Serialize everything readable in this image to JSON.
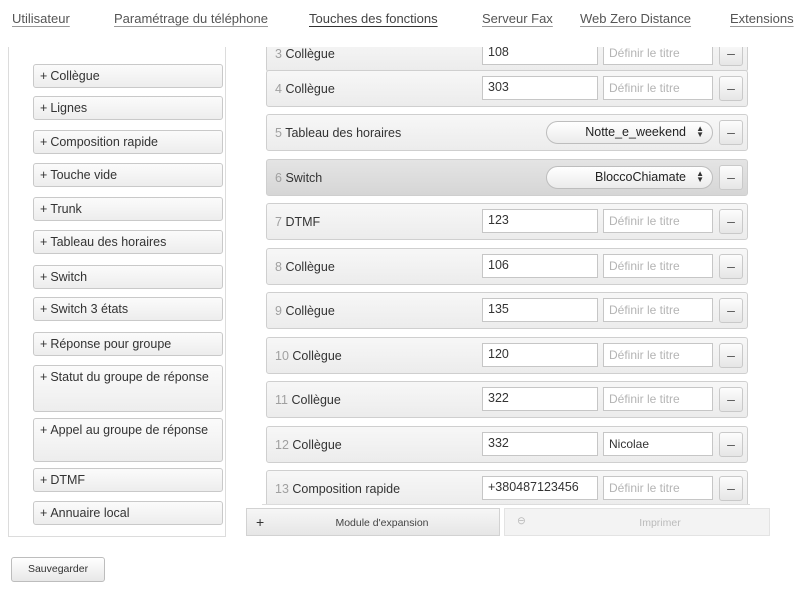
{
  "tabs": [
    {
      "label": "Utilisateur"
    },
    {
      "label": "Paramétrage du téléphone"
    },
    {
      "label": "Touches des fonctions"
    },
    {
      "label": "Serveur Fax"
    },
    {
      "label": "Web Zero Distance"
    },
    {
      "label": "Extensions"
    }
  ],
  "active_tab": "Touches des fonctions",
  "palette": {
    "plus_symbol": "+",
    "items": [
      {
        "label": "Collègue"
      },
      {
        "label": "Lignes"
      },
      {
        "label": "Composition rapide"
      },
      {
        "label": "Touche vide"
      },
      {
        "label": "Trunk"
      },
      {
        "label": "Tableau des horaires"
      },
      {
        "label": "Switch"
      },
      {
        "label": "Switch 3 états"
      },
      {
        "label": "Réponse pour groupe"
      },
      {
        "label": "Statut du groupe de réponse"
      },
      {
        "label": "Appel au groupe de réponse"
      },
      {
        "label": "DTMF"
      },
      {
        "label": "Annuaire local"
      }
    ]
  },
  "buttons": {
    "minus_symbol": "–",
    "title_placeholder": "Définir le titre",
    "rows": [
      {
        "num": "3",
        "type": "Collègue",
        "value": "108",
        "title": "",
        "kind": "input"
      },
      {
        "num": "4",
        "type": "Collègue",
        "value": "303",
        "title": "",
        "kind": "input"
      },
      {
        "num": "5",
        "type": "Tableau des horaires",
        "select": "Notte_e_weekend",
        "kind": "select"
      },
      {
        "num": "6",
        "type": "Switch",
        "select": "BloccoChiamate",
        "kind": "select",
        "selected": true
      },
      {
        "num": "7",
        "type": "DTMF",
        "value": "123",
        "title": "",
        "kind": "input"
      },
      {
        "num": "8",
        "type": "Collègue",
        "value": "106",
        "title": "",
        "kind": "input"
      },
      {
        "num": "9",
        "type": "Collègue",
        "value": "135",
        "title": "",
        "kind": "input"
      },
      {
        "num": "10",
        "type": "Collègue",
        "value": "120",
        "title": "",
        "kind": "input"
      },
      {
        "num": "11",
        "type": "Collègue",
        "value": "322",
        "title": "",
        "kind": "input"
      },
      {
        "num": "12",
        "type": "Collègue",
        "value": "332",
        "title": "Nicolae",
        "kind": "input"
      },
      {
        "num": "13",
        "type": "Composition rapide",
        "value": "+380487123456",
        "title": "",
        "kind": "input"
      }
    ]
  },
  "toolbar": {
    "expansion_plus": "+",
    "expansion_label": "Module d'expansion",
    "print_icon": "⊖",
    "print_label": "Imprimer"
  },
  "save_label": "Sauvegarder"
}
